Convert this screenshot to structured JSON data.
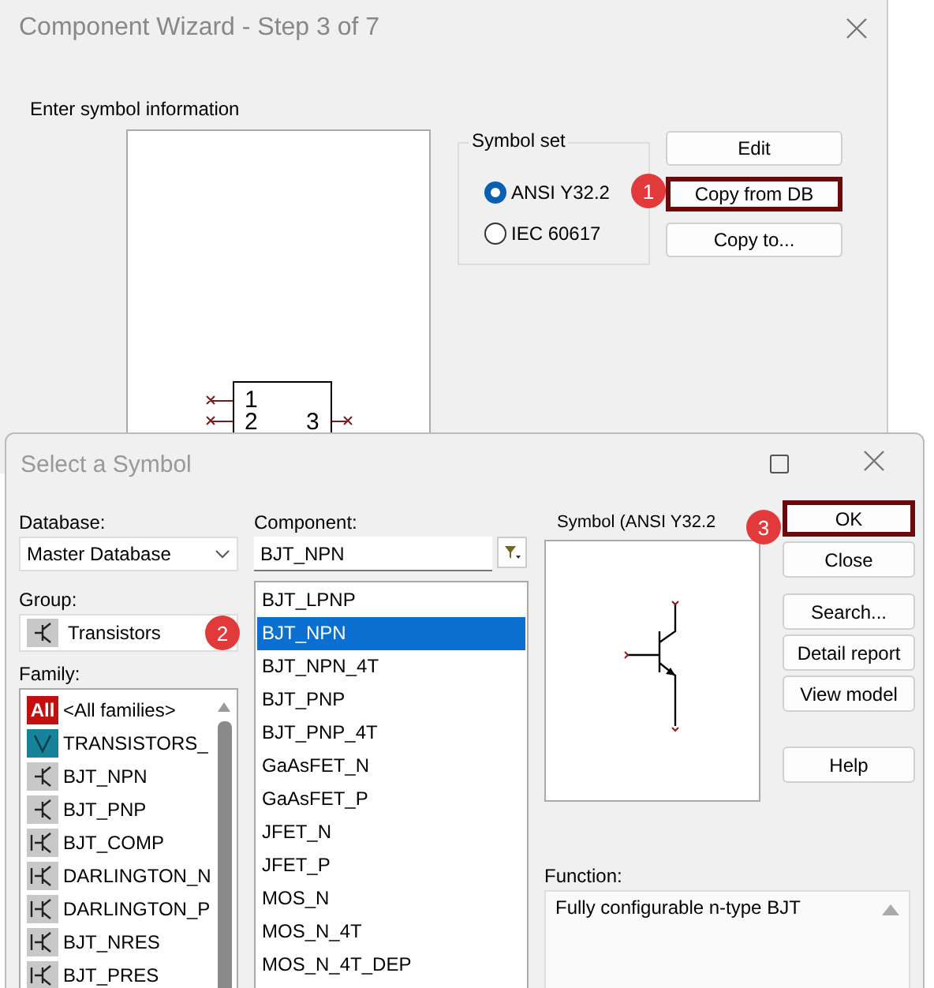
{
  "wizard": {
    "title": "Component Wizard - Step 3 of 7",
    "section_label": "Enter symbol information",
    "symbol_pins": [
      "1",
      "2",
      "3"
    ],
    "symbol_set": {
      "label": "Symbol set",
      "options": [
        {
          "label": "ANSI Y32.2",
          "selected": true
        },
        {
          "label": "IEC 60617",
          "selected": false
        }
      ]
    },
    "buttons": [
      {
        "label": "Edit",
        "highlighted": false
      },
      {
        "label": "Copy from DB",
        "highlighted": true
      },
      {
        "label": "Copy to...",
        "highlighted": false
      }
    ],
    "badge": "1"
  },
  "dialog": {
    "title": "Select a Symbol",
    "database": {
      "label": "Database:",
      "value": "Master Database"
    },
    "component": {
      "label": "Component:",
      "value": "BJT_NPN"
    },
    "group": {
      "label": "Group:",
      "value": "Transistors",
      "badge": "2"
    },
    "family": {
      "label": "Family:",
      "items": [
        {
          "kind": "all",
          "icon_text": "All",
          "label": "<All families>"
        },
        {
          "kind": "virtual",
          "label": "TRANSISTORS_"
        },
        {
          "kind": "part",
          "label": "BJT_NPN"
        },
        {
          "kind": "part",
          "label": "BJT_PNP"
        },
        {
          "kind": "part",
          "label": "BJT_COMP"
        },
        {
          "kind": "part",
          "label": "DARLINGTON_N"
        },
        {
          "kind": "part",
          "label": "DARLINGTON_P"
        },
        {
          "kind": "part",
          "label": "BJT_NRES"
        },
        {
          "kind": "part",
          "label": "BJT_PRES"
        }
      ]
    },
    "components": [
      {
        "label": "BJT_LPNP",
        "selected": false
      },
      {
        "label": "BJT_NPN",
        "selected": true
      },
      {
        "label": "BJT_NPN_4T",
        "selected": false
      },
      {
        "label": "BJT_PNP",
        "selected": false
      },
      {
        "label": "BJT_PNP_4T",
        "selected": false
      },
      {
        "label": "GaAsFET_N",
        "selected": false
      },
      {
        "label": "GaAsFET_P",
        "selected": false
      },
      {
        "label": "JFET_N",
        "selected": false
      },
      {
        "label": "JFET_P",
        "selected": false
      },
      {
        "label": "MOS_N",
        "selected": false
      },
      {
        "label": "MOS_N_4T",
        "selected": false
      },
      {
        "label": "MOS_N_4T_DEP",
        "selected": false
      }
    ],
    "symbol_label": "Symbol (ANSI Y32.2",
    "badge": "3",
    "button_groups": [
      [
        {
          "label": "OK",
          "highlighted": true
        },
        {
          "label": "Close",
          "highlighted": false
        }
      ],
      [
        {
          "label": "Search...",
          "highlighted": false
        },
        {
          "label": "Detail report",
          "highlighted": false
        },
        {
          "label": "View model",
          "highlighted": false
        }
      ],
      [
        {
          "label": "Help",
          "highlighted": false
        }
      ]
    ],
    "function": {
      "label": "Function:",
      "text": "Fully configurable n-type BJT"
    }
  }
}
